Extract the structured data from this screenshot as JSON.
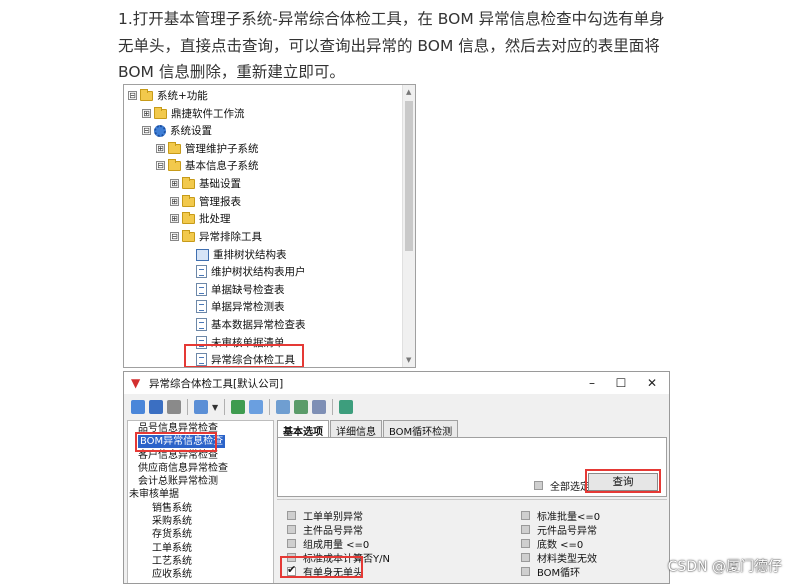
{
  "intro_text": "1.打开基本管理子系统-异常综合体检工具，在 BOM 异常信息检查中勾选有单身无单头，直接点击查询，可以查询出异常的 BOM 信息，然后去对应的表里面将 BOM 信息删除，重新建立即可。",
  "tree": {
    "nodes": [
      {
        "label": "系统+功能",
        "exp": "⊟",
        "icon": "folder-icon"
      },
      {
        "label": "鼎捷软件工作流",
        "exp": "⊞",
        "icon": "folder-icon"
      },
      {
        "label": "系统设置",
        "exp": "⊟",
        "icon": "gear-icon"
      },
      {
        "label": "管理维护子系统",
        "exp": "⊞",
        "icon": "folder-icon"
      },
      {
        "label": "基本信息子系统",
        "exp": "⊟",
        "icon": "folder-icon"
      },
      {
        "label": "基础设置",
        "exp": "⊞",
        "icon": "folder-icon"
      },
      {
        "label": "管理报表",
        "exp": "⊞",
        "icon": "folder-icon"
      },
      {
        "label": "批处理",
        "exp": "⊞",
        "icon": "folder-icon"
      },
      {
        "label": "异常排除工具",
        "exp": "⊟",
        "icon": "folder-icon"
      },
      {
        "label": "重排树状结构表",
        "exp": "",
        "icon": "table-icon"
      },
      {
        "label": "维护树状结构表用户",
        "exp": "",
        "icon": "user-doc-icon"
      },
      {
        "label": "单据缺号检查表",
        "exp": "",
        "icon": "report-icon"
      },
      {
        "label": "单据异常检测表",
        "exp": "",
        "icon": "report-icon"
      },
      {
        "label": "基本数据异常检查表",
        "exp": "",
        "icon": "report-icon"
      },
      {
        "label": "未审核单据清单",
        "exp": "",
        "icon": "report-icon"
      },
      {
        "label": "异常综合体检工具",
        "exp": "",
        "icon": "report-icon"
      }
    ]
  },
  "dialog": {
    "title": "异常综合体检工具[默认公司]",
    "minimize": "–",
    "maximize": "☐",
    "close": "✕",
    "left_items": [
      "品号信息异常检查",
      "BOM异常信息检查",
      "客户信息异常检查",
      "供应商信息异常检查",
      "会计总账异常检测",
      "未审核单据",
      "销售系统",
      "采购系统",
      "存货系统",
      "工单系统",
      "工艺系统",
      "应收系统"
    ],
    "tabs": [
      "基本选项",
      "详细信息",
      "BOM循环检测"
    ],
    "select_all_label": "全部选定",
    "query_button": "查询",
    "options_left": [
      "工单单别异常",
      "主件品号异常",
      "组成用量 <=0",
      "标准成本计算否Y/N",
      "有单身无单头"
    ],
    "options_right": [
      "标准批量<=0",
      "元件品号异常",
      "底数 <=0",
      "材料类型无效",
      "BOM循环"
    ]
  },
  "watermark": "CSDN @厦门德仔",
  "colors": {
    "highlight_red": "#e53935",
    "selection_blue": "#2b63c9",
    "folder_yellow": "#f2c94c"
  }
}
